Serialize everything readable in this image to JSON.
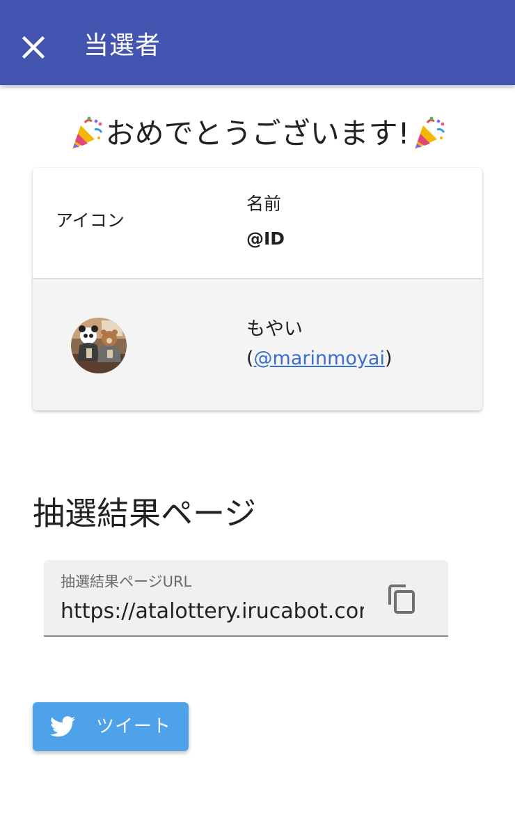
{
  "appbar": {
    "title": "当選者",
    "color": "#4253b0",
    "close_icon": "close-icon"
  },
  "congrats": {
    "icon": "party-popper-icon",
    "text": "おめでとうございます!"
  },
  "winner_table": {
    "headers": {
      "icon": "アイコン",
      "name": "名前",
      "id": "@ID"
    },
    "rows": [
      {
        "avatar": "avatar-image",
        "name": "もやい",
        "handle_open": "(",
        "handle": "@marinmoyai",
        "handle_close": ")"
      }
    ]
  },
  "result_section": {
    "title": "抽選結果ページ",
    "url_field": {
      "label": "抽選結果ページURL",
      "value": "https://atalottery.irucabot.com",
      "copy_icon": "copy-icon"
    }
  },
  "tweet_button": {
    "label": "ツイート",
    "icon": "twitter-bird-icon",
    "color": "#4da2ea"
  },
  "colors": {
    "link": "#3b6fcf"
  }
}
